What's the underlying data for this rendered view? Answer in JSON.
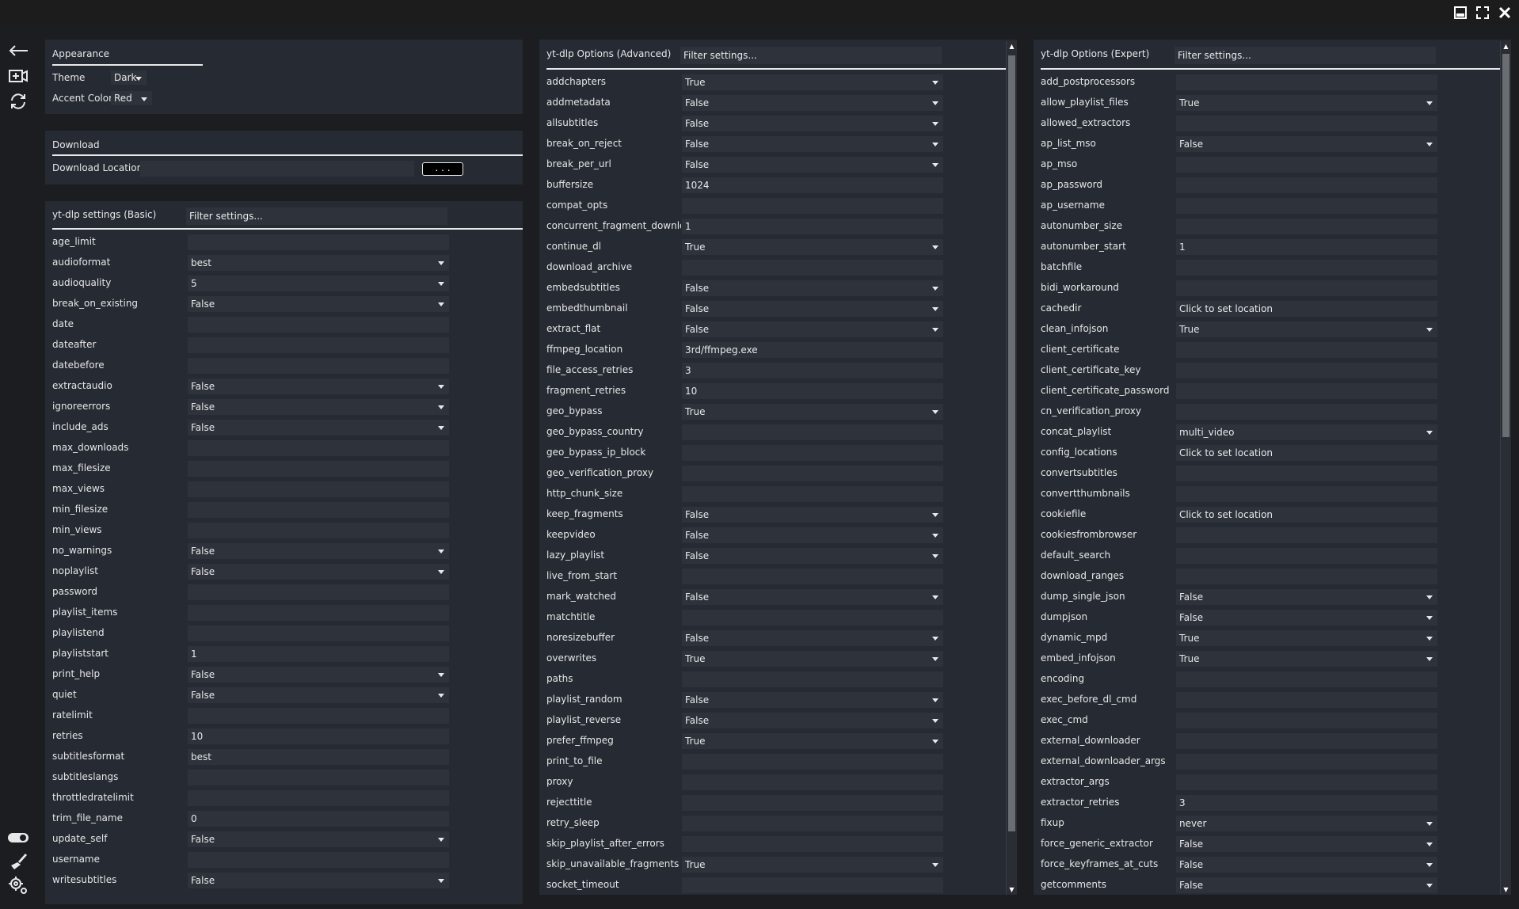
{
  "window": {
    "minimize_icon": "minimize-icon",
    "maximize_icon": "maximize-icon",
    "close_icon": "close-icon"
  },
  "sidebar": {
    "top": [
      "back-arrow-icon",
      "add-download-icon",
      "refresh-icon"
    ],
    "bottom": [
      "toggle-icon",
      "broom-icon",
      "settings-icon"
    ]
  },
  "appearance": {
    "title": "Appearance",
    "theme_label": "Theme",
    "theme_value": "Dark",
    "accent_label": "Accent Color",
    "accent_value": "Red"
  },
  "download": {
    "title": "Download",
    "location_label": "Download Location",
    "location_value": "",
    "browse_label": ". . ."
  },
  "basic": {
    "title": "yt-dlp settings (Basic)",
    "filter_placeholder": "Filter settings...",
    "rows": [
      {
        "name": "age_limit",
        "value": "",
        "select": false
      },
      {
        "name": "audioformat",
        "value": "best",
        "select": true
      },
      {
        "name": "audioquality",
        "value": "5",
        "select": true
      },
      {
        "name": "break_on_existing",
        "value": "False",
        "select": true
      },
      {
        "name": "date",
        "value": "",
        "select": false
      },
      {
        "name": "dateafter",
        "value": "",
        "select": false
      },
      {
        "name": "datebefore",
        "value": "",
        "select": false
      },
      {
        "name": "extractaudio",
        "value": "False",
        "select": true
      },
      {
        "name": "ignoreerrors",
        "value": "False",
        "select": true
      },
      {
        "name": "include_ads",
        "value": "False",
        "select": true
      },
      {
        "name": "max_downloads",
        "value": "",
        "select": false
      },
      {
        "name": "max_filesize",
        "value": "",
        "select": false
      },
      {
        "name": "max_views",
        "value": "",
        "select": false
      },
      {
        "name": "min_filesize",
        "value": "",
        "select": false
      },
      {
        "name": "min_views",
        "value": "",
        "select": false
      },
      {
        "name": "no_warnings",
        "value": "False",
        "select": true
      },
      {
        "name": "noplaylist",
        "value": "False",
        "select": true
      },
      {
        "name": "password",
        "value": "",
        "select": false
      },
      {
        "name": "playlist_items",
        "value": "",
        "select": false
      },
      {
        "name": "playlistend",
        "value": "",
        "select": false
      },
      {
        "name": "playliststart",
        "value": "1",
        "select": false
      },
      {
        "name": "print_help",
        "value": "False",
        "select": true
      },
      {
        "name": "quiet",
        "value": "False",
        "select": true
      },
      {
        "name": "ratelimit",
        "value": "",
        "select": false
      },
      {
        "name": "retries",
        "value": "10",
        "select": false
      },
      {
        "name": "subtitlesformat",
        "value": "best",
        "select": false
      },
      {
        "name": "subtitleslangs",
        "value": "",
        "select": false
      },
      {
        "name": "throttledratelimit",
        "value": "",
        "select": false
      },
      {
        "name": "trim_file_name",
        "value": "0",
        "select": false
      },
      {
        "name": "update_self",
        "value": "False",
        "select": true
      },
      {
        "name": "username",
        "value": "",
        "select": false
      },
      {
        "name": "writesubtitles",
        "value": "False",
        "select": true
      }
    ]
  },
  "advanced": {
    "title": "yt-dlp Options (Advanced)",
    "filter_placeholder": "Filter settings...",
    "rows": [
      {
        "name": "addchapters",
        "value": "True",
        "select": true
      },
      {
        "name": "addmetadata",
        "value": "False",
        "select": true
      },
      {
        "name": "allsubtitles",
        "value": "False",
        "select": true
      },
      {
        "name": "break_on_reject",
        "value": "False",
        "select": true
      },
      {
        "name": "break_per_url",
        "value": "False",
        "select": true
      },
      {
        "name": "buffersize",
        "value": "1024",
        "select": false
      },
      {
        "name": "compat_opts",
        "value": "",
        "select": false
      },
      {
        "name": "concurrent_fragment_download",
        "value": "1",
        "select": false
      },
      {
        "name": "continue_dl",
        "value": "True",
        "select": true
      },
      {
        "name": "download_archive",
        "value": "",
        "select": false
      },
      {
        "name": "embedsubtitles",
        "value": "False",
        "select": true
      },
      {
        "name": "embedthumbnail",
        "value": "False",
        "select": true
      },
      {
        "name": "extract_flat",
        "value": "False",
        "select": true
      },
      {
        "name": "ffmpeg_location",
        "value": "3rd/ffmpeg.exe",
        "select": false
      },
      {
        "name": "file_access_retries",
        "value": "3",
        "select": false
      },
      {
        "name": "fragment_retries",
        "value": "10",
        "select": false
      },
      {
        "name": "geo_bypass",
        "value": "True",
        "select": true
      },
      {
        "name": "geo_bypass_country",
        "value": "",
        "select": false
      },
      {
        "name": "geo_bypass_ip_block",
        "value": "",
        "select": false
      },
      {
        "name": "geo_verification_proxy",
        "value": "",
        "select": false
      },
      {
        "name": "http_chunk_size",
        "value": "",
        "select": false
      },
      {
        "name": "keep_fragments",
        "value": "False",
        "select": true
      },
      {
        "name": "keepvideo",
        "value": "False",
        "select": true
      },
      {
        "name": "lazy_playlist",
        "value": "False",
        "select": true
      },
      {
        "name": "live_from_start",
        "value": "",
        "select": false
      },
      {
        "name": "mark_watched",
        "value": "False",
        "select": true
      },
      {
        "name": "matchtitle",
        "value": "",
        "select": false
      },
      {
        "name": "noresizebuffer",
        "value": "False",
        "select": true
      },
      {
        "name": "overwrites",
        "value": "True",
        "select": true
      },
      {
        "name": "paths",
        "value": "",
        "select": false
      },
      {
        "name": "playlist_random",
        "value": "False",
        "select": true
      },
      {
        "name": "playlist_reverse",
        "value": "False",
        "select": true
      },
      {
        "name": "prefer_ffmpeg",
        "value": "True",
        "select": true
      },
      {
        "name": "print_to_file",
        "value": "",
        "select": false
      },
      {
        "name": "proxy",
        "value": "",
        "select": false
      },
      {
        "name": "rejecttitle",
        "value": "",
        "select": false
      },
      {
        "name": "retry_sleep",
        "value": "",
        "select": false
      },
      {
        "name": "skip_playlist_after_errors",
        "value": "",
        "select": false
      },
      {
        "name": "skip_unavailable_fragments",
        "value": "True",
        "select": true
      },
      {
        "name": "socket_timeout",
        "value": "",
        "select": false
      }
    ]
  },
  "expert": {
    "title": "yt-dlp Options (Expert)",
    "filter_placeholder": "Filter settings...",
    "rows": [
      {
        "name": "add_postprocessors",
        "value": "",
        "select": false
      },
      {
        "name": "allow_playlist_files",
        "value": "True",
        "select": true
      },
      {
        "name": "allowed_extractors",
        "value": "",
        "select": false
      },
      {
        "name": "ap_list_mso",
        "value": "False",
        "select": true
      },
      {
        "name": "ap_mso",
        "value": "",
        "select": false
      },
      {
        "name": "ap_password",
        "value": "",
        "select": false
      },
      {
        "name": "ap_username",
        "value": "",
        "select": false
      },
      {
        "name": "autonumber_size",
        "value": "",
        "select": false
      },
      {
        "name": "autonumber_start",
        "value": "1",
        "select": false
      },
      {
        "name": "batchfile",
        "value": "",
        "select": false
      },
      {
        "name": "bidi_workaround",
        "value": "",
        "select": false
      },
      {
        "name": "cachedir",
        "value": "Click to set location",
        "select": false
      },
      {
        "name": "clean_infojson",
        "value": "True",
        "select": true
      },
      {
        "name": "client_certificate",
        "value": "",
        "select": false
      },
      {
        "name": "client_certificate_key",
        "value": "",
        "select": false
      },
      {
        "name": "client_certificate_password",
        "value": "",
        "select": false
      },
      {
        "name": "cn_verification_proxy",
        "value": "",
        "select": false
      },
      {
        "name": "concat_playlist",
        "value": "multi_video",
        "select": true
      },
      {
        "name": "config_locations",
        "value": "Click to set location",
        "select": false
      },
      {
        "name": "convertsubtitles",
        "value": "",
        "select": false
      },
      {
        "name": "convertthumbnails",
        "value": "",
        "select": false
      },
      {
        "name": "cookiefile",
        "value": "Click to set location",
        "select": false
      },
      {
        "name": "cookiesfrombrowser",
        "value": "",
        "select": false
      },
      {
        "name": "default_search",
        "value": "",
        "select": false
      },
      {
        "name": "download_ranges",
        "value": "",
        "select": false
      },
      {
        "name": "dump_single_json",
        "value": "False",
        "select": true
      },
      {
        "name": "dumpjson",
        "value": "False",
        "select": true
      },
      {
        "name": "dynamic_mpd",
        "value": "True",
        "select": true
      },
      {
        "name": "embed_infojson",
        "value": "True",
        "select": true
      },
      {
        "name": "encoding",
        "value": "",
        "select": false
      },
      {
        "name": "exec_before_dl_cmd",
        "value": "",
        "select": false
      },
      {
        "name": "exec_cmd",
        "value": "",
        "select": false
      },
      {
        "name": "external_downloader",
        "value": "",
        "select": false
      },
      {
        "name": "external_downloader_args",
        "value": "",
        "select": false
      },
      {
        "name": "extractor_args",
        "value": "",
        "select": false
      },
      {
        "name": "extractor_retries",
        "value": "3",
        "select": false
      },
      {
        "name": "fixup",
        "value": "never",
        "select": true
      },
      {
        "name": "force_generic_extractor",
        "value": "False",
        "select": true
      },
      {
        "name": "force_keyframes_at_cuts",
        "value": "False",
        "select": true
      },
      {
        "name": "getcomments",
        "value": "False",
        "select": true
      }
    ]
  }
}
